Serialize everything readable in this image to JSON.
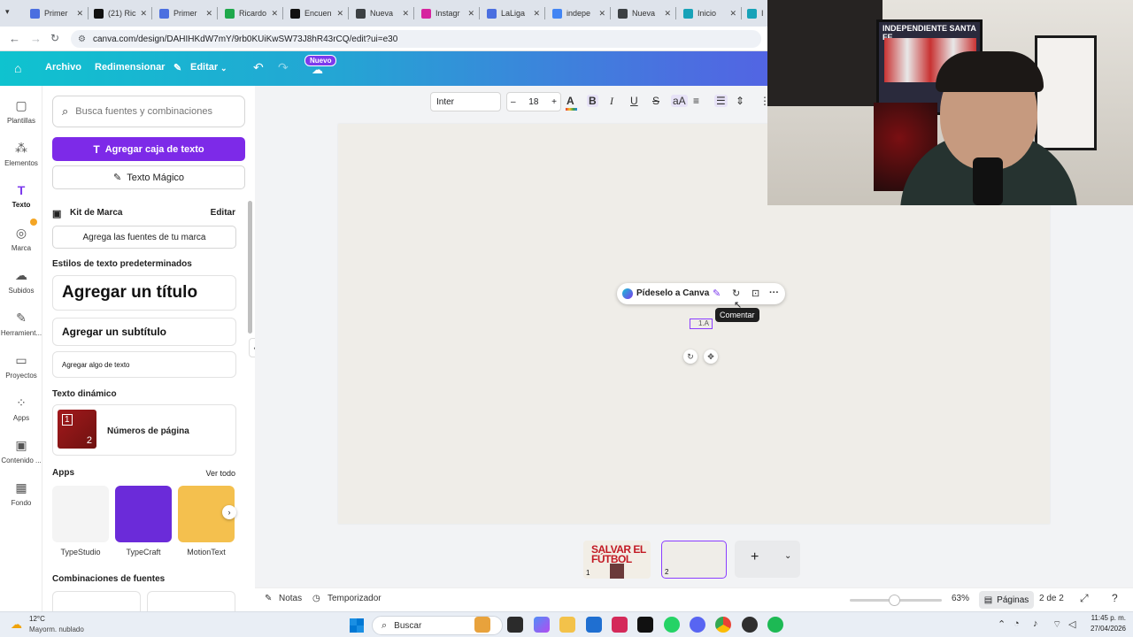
{
  "browser": {
    "tabs": [
      {
        "title": "Primer",
        "color": "#4b6fe0"
      },
      {
        "title": "(21) Ric",
        "color": "#111111"
      },
      {
        "title": "Primer",
        "color": "#4b6fe0"
      },
      {
        "title": "Ricardo",
        "color": "#1ea84b"
      },
      {
        "title": "Encuen",
        "color": "#111111"
      },
      {
        "title": "Nueva",
        "color": "#3c4043"
      },
      {
        "title": "Instagr",
        "color": "#d6249f"
      },
      {
        "title": "LaLiga",
        "color": "#4b6fe0"
      },
      {
        "title": "indepe",
        "color": "#4285f4"
      },
      {
        "title": "Nueva",
        "color": "#3c4043"
      },
      {
        "title": "Inicio",
        "color": "#17a2b8"
      },
      {
        "title": "In",
        "color": "#17a2b8"
      }
    ],
    "url": "canva.com/design/DAHIHKdW7mY/9rb0KUiKwSW73J8hR43rCQ/edit?ui=e30"
  },
  "header": {
    "archivo": "Archivo",
    "redimensionar": "Redimensionar",
    "editar": "Editar",
    "nuevo_badge": "Nuevo"
  },
  "rail": [
    {
      "label": "Plantillas",
      "icon": "▢"
    },
    {
      "label": "Elementos",
      "icon": "⁂"
    },
    {
      "label": "Texto",
      "icon": "T"
    },
    {
      "label": "Marca",
      "icon": "◎"
    },
    {
      "label": "Subidos",
      "icon": "☁"
    },
    {
      "label": "Herramient...",
      "icon": "✎"
    },
    {
      "label": "Proyectos",
      "icon": "▭"
    },
    {
      "label": "Apps",
      "icon": "⁘"
    },
    {
      "label": "Contenido ...",
      "icon": "▣"
    },
    {
      "label": "Fondo",
      "icon": "▦"
    }
  ],
  "panel": {
    "search_placeholder": "Busca fuentes y combinaciones",
    "add_textbox": "Agregar caja de texto",
    "magic_text": "Texto Mágico",
    "brand_kit": "Kit de Marca",
    "edit": "Editar",
    "add_brand_fonts": "Agrega las fuentes de tu marca",
    "default_styles": "Estilos de texto predeterminados",
    "add_title": "Agregar un título",
    "add_subtitle": "Agregar un subtítulo",
    "add_body": "Agregar algo de texto",
    "dynamic_text": "Texto dinámico",
    "page_numbers": "Números de página",
    "apps_heading": "Apps",
    "see_all": "Ver todo",
    "apps": [
      {
        "name": "TypeStudio",
        "color": "#f4f4f4"
      },
      {
        "name": "TypeCraft",
        "color": "#6b2bd9"
      },
      {
        "name": "MotionText",
        "color": "#f4c04e"
      }
    ],
    "font_combos": "Combinaciones de fuentes"
  },
  "toolbar": {
    "font": "Inter",
    "size": "18",
    "minus": "–",
    "plus": "+"
  },
  "canvas": {
    "ask_canva": "Pídeselo a Canva",
    "tooltip": "Comentar",
    "selected_text": "1.A"
  },
  "pages": {
    "thumb1_title": "SALVAR EL FÚTBOL",
    "thumb1_num": "1",
    "thumb2_num": "2"
  },
  "status": {
    "notes": "Notas",
    "timer": "Temporizador",
    "zoom": "63%",
    "zoom_level": 0.42,
    "pages_btn": "Páginas",
    "page_count": "2 de 2"
  },
  "webcam": {
    "poster_text": "INDEPENDIENTE SANTA FE"
  },
  "taskbar": {
    "temperature": "12°C",
    "weather": "Mayorm. nublado",
    "search": "Buscar",
    "time": "11:45 p. m.",
    "date": "27/04/2026"
  }
}
